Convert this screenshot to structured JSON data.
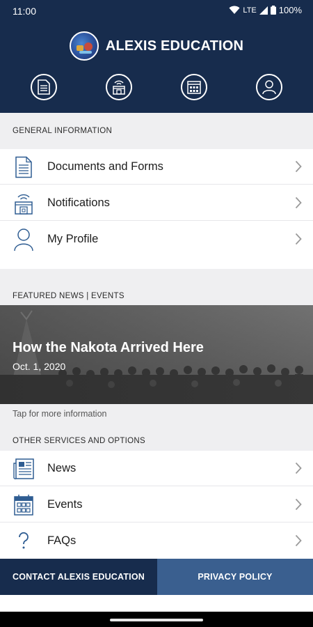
{
  "status_bar": {
    "time": "11:00",
    "network": "LTE",
    "battery": "100%"
  },
  "header": {
    "app_title": "ALEXIS EDUCATION",
    "quick_actions": [
      {
        "icon": "document-icon"
      },
      {
        "icon": "notification-building-icon"
      },
      {
        "icon": "calendar-icon"
      },
      {
        "icon": "user-icon"
      }
    ]
  },
  "general": {
    "heading": "GENERAL INFORMATION",
    "items": [
      {
        "label": "Documents and Forms",
        "icon": "document-icon"
      },
      {
        "label": "Notifications",
        "icon": "notification-building-icon"
      },
      {
        "label": "My Profile",
        "icon": "user-icon"
      }
    ]
  },
  "featured": {
    "heading": "FEATURED NEWS | EVENTS",
    "title": "How the Nakota Arrived Here",
    "date": "Oct. 1, 2020",
    "hint": "Tap for more information"
  },
  "other": {
    "heading": "OTHER SERVICES AND OPTIONS",
    "items": [
      {
        "label": "News",
        "icon": "newspaper-icon"
      },
      {
        "label": "Events",
        "icon": "calendar-icon"
      },
      {
        "label": "FAQs",
        "icon": "question-icon"
      }
    ]
  },
  "footer": {
    "contact_label": "CONTACT ALEXIS EDUCATION",
    "privacy_label": "PRIVACY POLICY"
  },
  "colors": {
    "header_bg": "#172c4d",
    "privacy_bg": "#3a5f8f",
    "icon_accent": "#2f5d92",
    "section_bg": "#efeff1"
  }
}
